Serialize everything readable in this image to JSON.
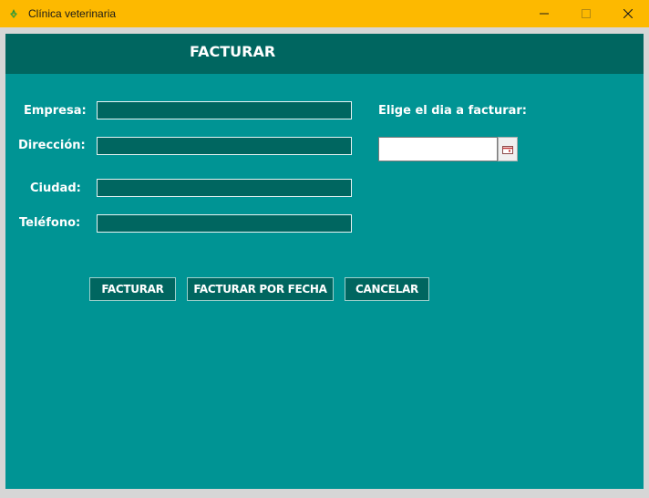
{
  "window": {
    "title": "Clínica veterinaria",
    "app_icon": "app-logo-icon",
    "controls": [
      "minimize-icon",
      "maximize-icon",
      "close-icon"
    ]
  },
  "header": {
    "title": "FACTURAR"
  },
  "form": {
    "empresa": {
      "label": "Empresa:",
      "value": ""
    },
    "direccion": {
      "label": "Dirección:",
      "value": ""
    },
    "ciudad": {
      "label": "Ciudad:",
      "value": ""
    },
    "telefono": {
      "label": "Teléfono:",
      "value": ""
    }
  },
  "date_picker": {
    "label": "Elige el dia a facturar:",
    "value": "",
    "button_icon": "calendar-icon"
  },
  "buttons": {
    "facturar": "FACTURAR",
    "facturar_por_fecha": "FACTURAR POR FECHA",
    "cancelar": "CANCELAR"
  },
  "colors": {
    "titlebar": "#fdb900",
    "panel": "#009494",
    "header": "#006660",
    "field_bg": "#006660",
    "text": "#ffffff"
  }
}
